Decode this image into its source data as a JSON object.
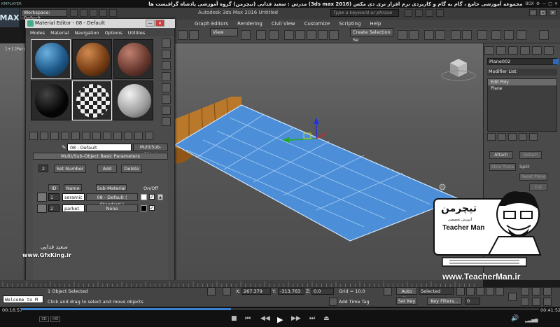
{
  "player": {
    "logo": "KMPLAYER",
    "title": "مجموعه آموزشی جامع ، گام به گام و کاربردی نرم افزار تری دی مکس (3ds max 2016)   مدرس : سعید فدایی (تیچرمن) گروه آموزشی پادشاه گرافیست ها",
    "controls_right": [
      "BOX",
      "⚙",
      "—",
      "□",
      "✕"
    ],
    "time_elapsed": "00:16:57",
    "time_total": "00:41:52",
    "progress": 0.405,
    "tags": [
      "3D",
      "HD"
    ]
  },
  "max": {
    "logo": "MAX",
    "workspace": "Workspace: Default",
    "app_title": "Autodesk 3ds Max 2016    Untitled",
    "search_placeholder": "Type a keyword or phrase",
    "window_controls": [
      "—",
      "□",
      "✕"
    ],
    "menu": [
      "Graph Editors",
      "Rendering",
      "Civil View",
      "Customize",
      "Scripting",
      "Help"
    ],
    "toolbar": {
      "view_dropdown": "View",
      "selection_set": "Create Selection Se"
    },
    "viewport_label": "[+] [Perspective] [Realistic]"
  },
  "command_panel": {
    "object_name": "Plane002",
    "modifier_list": "Modifier List",
    "stack": [
      "Edit Poly",
      "Plane"
    ],
    "attach": "Attach",
    "detach": "Detach",
    "slice_plane": "Slice Plane",
    "split": "Split",
    "reset_plane": "Reset Plane",
    "cut": "Cut"
  },
  "material_editor": {
    "title": "Material Editor - 08 - Default",
    "menu": [
      "Modes",
      "Material",
      "Navigation",
      "Options",
      "Utilities"
    ],
    "material_name": "08 - Default",
    "material_type": "Multi/Sub-Object",
    "rollout": "Multi/Sub-Object Basic Parameters",
    "count": "2",
    "set_number": "Set Number",
    "add": "Add",
    "delete": "Delete",
    "headers": {
      "id": "ID",
      "name": "Name",
      "sub": "Sub-Material",
      "onoff": "On/Off"
    },
    "rows": [
      {
        "id": "1",
        "name": "seramic",
        "sub": "08 - Default  ( Standard )",
        "color": "#ffffff",
        "checked": "✓"
      },
      {
        "id": "2",
        "name": "parket",
        "sub": "None",
        "color": "#000000",
        "checked": "✓"
      }
    ],
    "watermark": "سعید فدایی",
    "site": "www.GfxKing.ir"
  },
  "status": {
    "listener": "Welcome to M",
    "selected": "1 Object Selected",
    "prompt": "Click and drag to select and move objects",
    "x_label": "X:",
    "x": "267.379",
    "y_label": "Y:",
    "y": "-313.763",
    "z_label": "Z:",
    "z": "0.0",
    "grid": "Grid = 10.0",
    "add_time_tag": "Add Time Tag",
    "auto_key": "Auto Key",
    "set_key": "Set Key",
    "selected_dd": "Selected",
    "key_filters": "Key Filters...",
    "frame": "0"
  },
  "badge": {
    "persian_name": "تیچرمن",
    "subtitle": "آموزش تخصصی",
    "name": "Teacher Man",
    "url": "www.TeacherMan.ir"
  },
  "colors": {
    "plane_blue": "#4c8fd8",
    "bench_orange": "#c8822a"
  }
}
